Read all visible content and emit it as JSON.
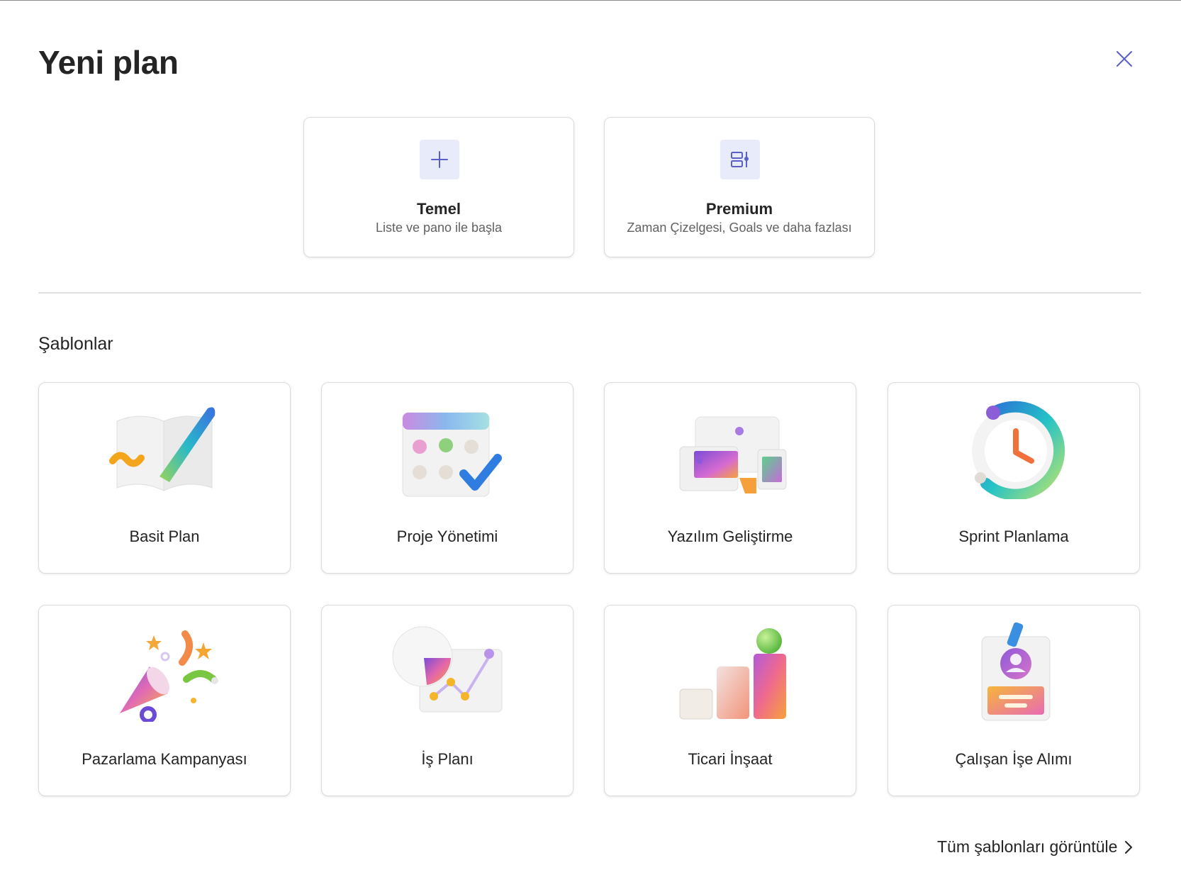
{
  "dialog": {
    "title": "Yeni plan",
    "close_icon": "close-icon"
  },
  "start_options": [
    {
      "title": "Temel",
      "subtitle": "Liste ve pano ile başla",
      "icon": "plus-icon"
    },
    {
      "title": "Premium",
      "subtitle": "Zaman Çizelgesi, Goals ve daha fazlası",
      "icon": "premium-layout-icon"
    }
  ],
  "templates": {
    "heading": "Şablonlar",
    "items": [
      {
        "label": "Basit Plan",
        "icon": "open-book-pen-illustration"
      },
      {
        "label": "Proje Yönetimi",
        "icon": "calendar-check-illustration"
      },
      {
        "label": "Yazılım Geliştirme",
        "icon": "screens-illustration"
      },
      {
        "label": "Sprint Planlama",
        "icon": "clock-ring-illustration"
      },
      {
        "label": "Pazarlama Kampanyası",
        "icon": "megaphone-confetti-illustration"
      },
      {
        "label": "İş Planı",
        "icon": "line-chart-illustration"
      },
      {
        "label": "Ticari İnşaat",
        "icon": "building-blocks-illustration"
      },
      {
        "label": "Çalışan İşe Alımı",
        "icon": "id-badge-illustration"
      }
    ],
    "view_all": "Tüm şablonları görüntüle",
    "view_all_icon": "chevron-right-icon"
  },
  "colors": {
    "accent": "#5b5fc7",
    "icon_tile_bg": "#e8ebfa"
  }
}
